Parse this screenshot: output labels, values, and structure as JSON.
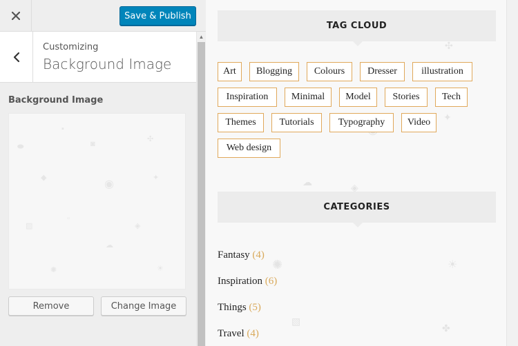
{
  "panel": {
    "close_icon": "close-icon",
    "publish_label": "Save & Publish",
    "back_icon": "chevron-left-icon",
    "customizing_label": "Customizing",
    "section_name": "Background Image",
    "control_label": "Background Image",
    "remove_label": "Remove",
    "change_label": "Change Image",
    "accent_color": "#0085ba"
  },
  "preview": {
    "tag_cloud_title": "TAG CLOUD",
    "tags": [
      "Art",
      "Blogging",
      "Colours",
      "Dresser",
      "illustration",
      "Inspiration",
      "Minimal",
      "Model",
      "Stories",
      "Tech",
      "Themes",
      "Tutorials",
      "Typography",
      "Video",
      "Web design"
    ],
    "categories_title": "CATEGORIES",
    "categories": [
      {
        "name": "Fantasy",
        "count": "(4)"
      },
      {
        "name": "Inspiration",
        "count": "(6)"
      },
      {
        "name": "Things",
        "count": "(5)"
      },
      {
        "name": "Travel",
        "count": "(4)"
      }
    ],
    "tag_border_color": "#e0a85a",
    "count_color": "#d9a95a"
  }
}
